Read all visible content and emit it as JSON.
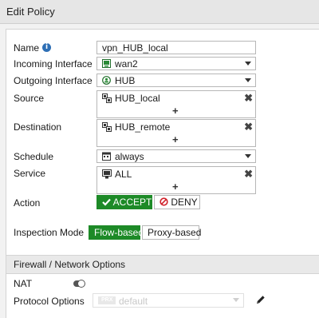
{
  "header": {
    "title": "Edit Policy"
  },
  "form": {
    "name": {
      "label": "Name",
      "value": "vpn_HUB_local"
    },
    "incoming": {
      "label": "Incoming Interface",
      "value": "wan2"
    },
    "outgoing": {
      "label": "Outgoing Interface",
      "value": "HUB"
    },
    "source": {
      "label": "Source",
      "value": "HUB_local",
      "add": "+",
      "remove": "✖"
    },
    "destination": {
      "label": "Destination",
      "value": "HUB_remote",
      "add": "+",
      "remove": "✖"
    },
    "schedule": {
      "label": "Schedule",
      "value": "always"
    },
    "service": {
      "label": "Service",
      "value": "ALL",
      "add": "+",
      "remove": "✖"
    },
    "action": {
      "label": "Action",
      "accept": "ACCEPT",
      "deny": "DENY",
      "selected": "ACCEPT"
    },
    "inspection": {
      "label": "Inspection Mode",
      "flow": "Flow-based",
      "proxy": "Proxy-based",
      "selected": "Flow-based"
    }
  },
  "firewall_section": {
    "title": "Firewall / Network Options",
    "nat": {
      "label": "NAT",
      "enabled": false
    },
    "protocol_options": {
      "label": "Protocol Options",
      "badge": "PRX",
      "value": "default"
    }
  },
  "colors": {
    "accent_green": "#1d8a27",
    "deny_red": "#d0212a",
    "info_blue": "#2e6fb5"
  },
  "icons": {
    "name_info": "info-icon",
    "incoming": "interface-port-icon",
    "outgoing": "vpn-tunnel-icon",
    "address": "address-object-icon",
    "schedule": "calendar-icon",
    "service": "service-icon",
    "accept": "checkmark-icon",
    "deny": "deny-circle-icon",
    "edit": "pencil-icon"
  }
}
